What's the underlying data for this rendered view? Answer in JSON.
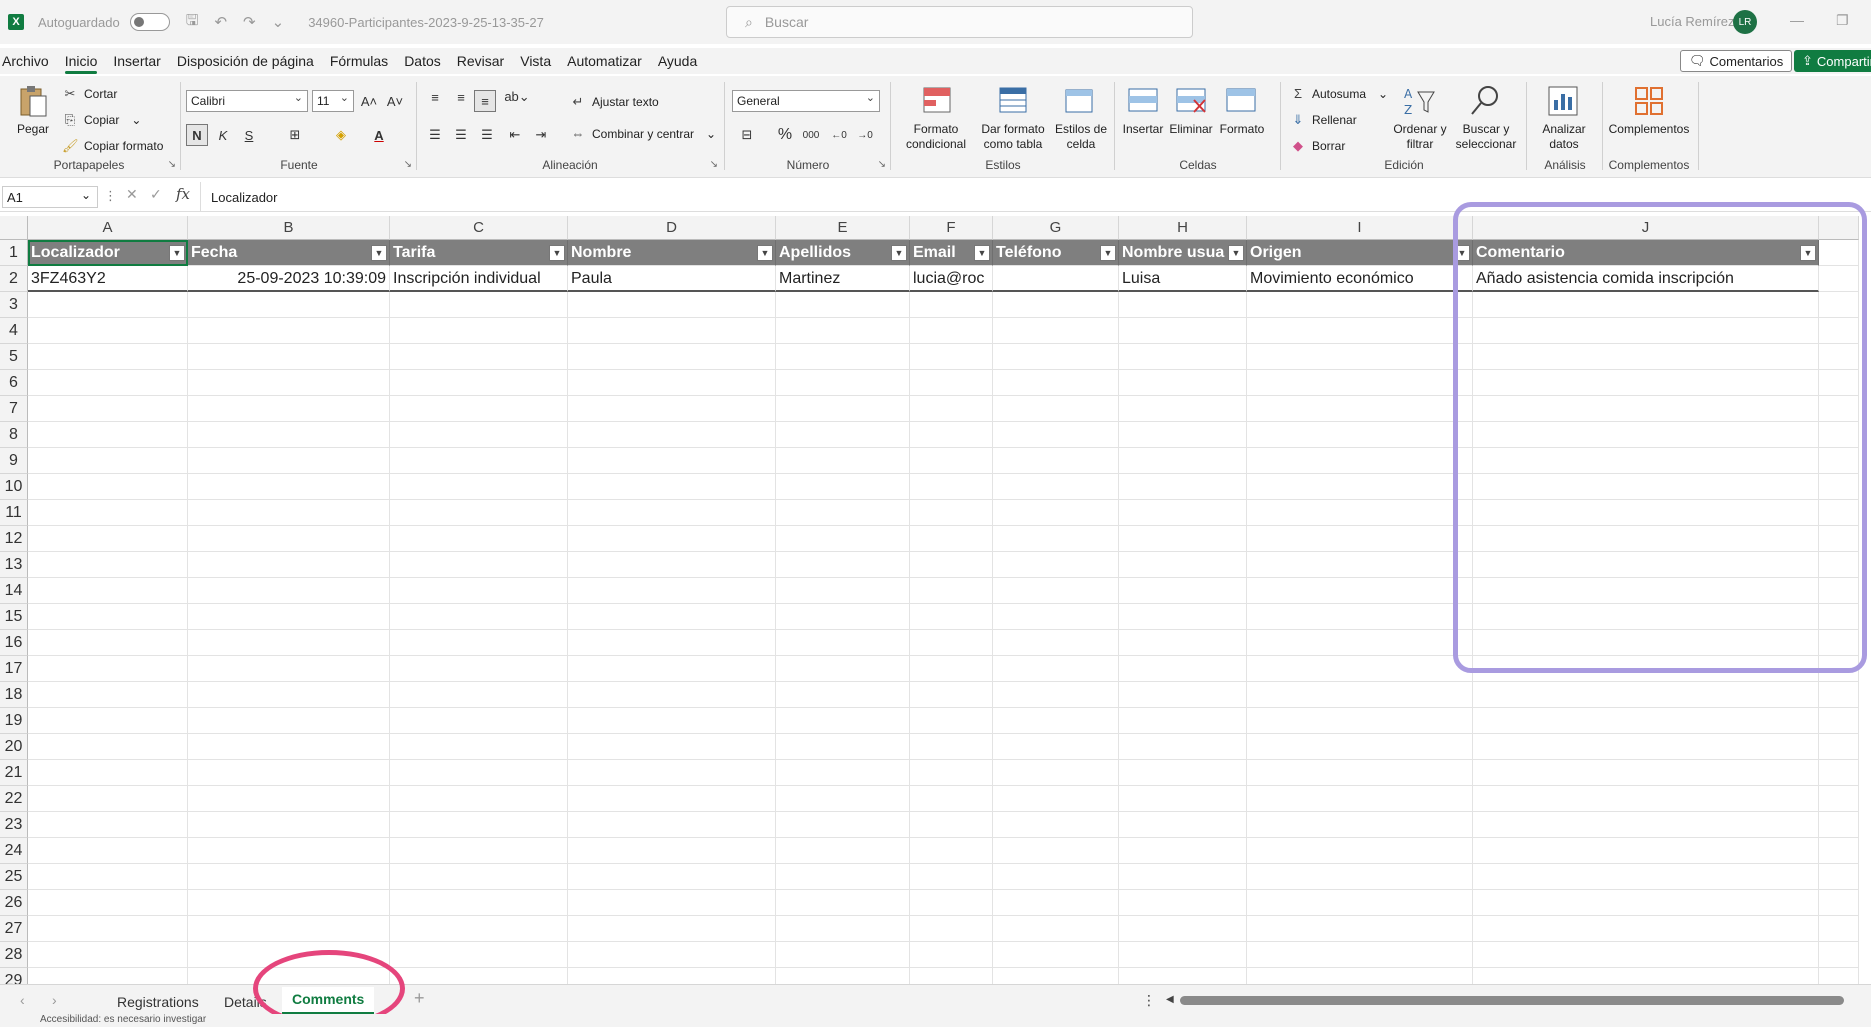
{
  "titlebar": {
    "autosave_label": "Autoguardado",
    "filename": "34960-Participantes-2023-9-25-13-35-27",
    "search_placeholder": "Buscar",
    "user_name": "Lucía Remírez",
    "user_initials": "LR"
  },
  "menu": {
    "items": [
      "Archivo",
      "Inicio",
      "Insertar",
      "Disposición de página",
      "Fórmulas",
      "Datos",
      "Revisar",
      "Vista",
      "Automatizar",
      "Ayuda"
    ],
    "active": "Inicio",
    "comments_label": "Comentarios",
    "share_label": "Compartir"
  },
  "ribbon": {
    "clipboard": {
      "paste": "Pegar",
      "cut": "Cortar",
      "copy": "Copiar",
      "format_painter": "Copiar formato",
      "label": "Portapapeles"
    },
    "font": {
      "name": "Calibri",
      "size": "11",
      "bold": "N",
      "italic": "K",
      "underline": "S",
      "label": "Fuente"
    },
    "alignment": {
      "wrap": "Ajustar texto",
      "merge": "Combinar y centrar",
      "label": "Alineación"
    },
    "number": {
      "format": "General",
      "label": "Número"
    },
    "styles": {
      "conditional": "Formato condicional",
      "as_table": "Dar formato como tabla",
      "cell_styles": "Estilos de celda",
      "label": "Estilos"
    },
    "cells": {
      "insert": "Insertar",
      "delete": "Eliminar",
      "format": "Formato",
      "label": "Celdas"
    },
    "editing": {
      "autosum": "Autosuma",
      "fill": "Rellenar",
      "clear": "Borrar",
      "sort": "Ordenar y filtrar",
      "find": "Buscar y seleccionar",
      "label": "Edición"
    },
    "analysis": {
      "analyze": "Analizar datos",
      "label": "Análisis"
    },
    "addins": {
      "addins": "Complementos",
      "label": "Complementos"
    }
  },
  "formula_bar": {
    "name_box": "A1",
    "formula": "Localizador"
  },
  "columns": [
    "A",
    "B",
    "C",
    "D",
    "E",
    "F",
    "G",
    "H",
    "I",
    "J"
  ],
  "table": {
    "headers": [
      "Localizador",
      "Fecha",
      "Tarifa",
      "Nombre",
      "Apellidos",
      "Email",
      "Teléfono",
      "Nombre usua",
      "Origen",
      "Comentario"
    ],
    "rows": [
      [
        "3FZ463Y2",
        "25-09-2023 10:39:09",
        "Inscripción individual",
        "Paula",
        "Martinez",
        "lucia@roc",
        "",
        "Luisa",
        "Movimiento económico",
        "Añado asistencia comida inscripción"
      ]
    ]
  },
  "row_numbers": [
    "1",
    "2",
    "3",
    "4",
    "5",
    "6",
    "7",
    "8",
    "9",
    "10",
    "11",
    "12",
    "13",
    "14",
    "15",
    "16",
    "17",
    "18",
    "19",
    "20",
    "21",
    "22",
    "23",
    "24",
    "25",
    "26",
    "27",
    "28",
    "29"
  ],
  "sheets": {
    "tabs": [
      "Registrations",
      "Details",
      "Comments"
    ],
    "active": "Comments"
  },
  "status": {
    "text": "Accesibilidad: es necesario investigar"
  },
  "colors": {
    "accent": "#107c41",
    "header_fill": "#7f7f7f",
    "annotation_rect": "#a99be0",
    "annotation_ellipse": "#e5457c"
  }
}
